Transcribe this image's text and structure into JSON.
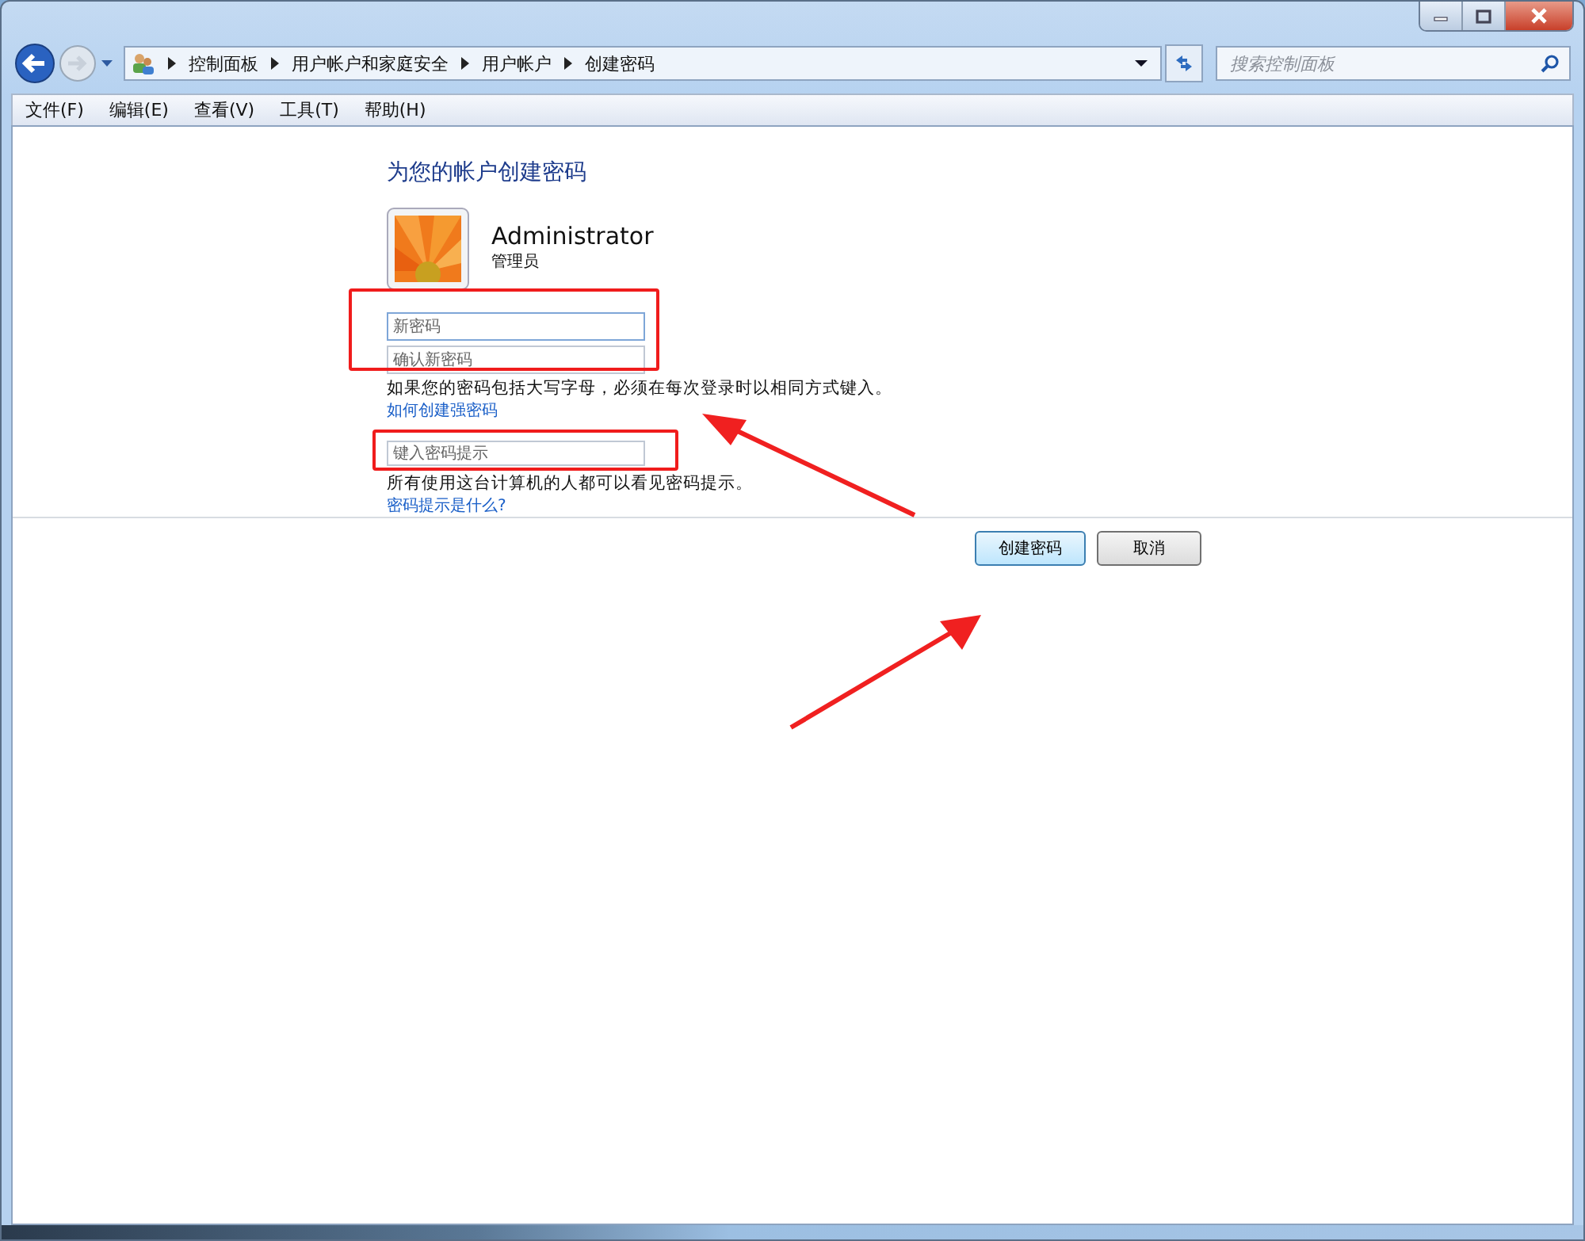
{
  "window": {
    "controls": [
      {
        "kind": "minimize"
      },
      {
        "kind": "maximize"
      },
      {
        "kind": "close"
      }
    ]
  },
  "nav": {
    "breadcrumbs": [
      "控制面板",
      "用户帐户和家庭安全",
      "用户帐户",
      "创建密码"
    ],
    "search": {
      "placeholder": "搜索控制面板"
    }
  },
  "menu": [
    "文件(F)",
    "编辑(E)",
    "查看(V)",
    "工具(T)",
    "帮助(H)"
  ],
  "page": {
    "heading": "为您的帐户创建密码",
    "account": {
      "name": "Administrator",
      "role": "管理员"
    },
    "password_fields": [
      {
        "placeholder": "新密码",
        "focused": true
      },
      {
        "placeholder": "确认新密码",
        "focused": false
      }
    ],
    "case_note": "如果您的密码包括大写字母，必须在每次登录时以相同方式键入。",
    "strong_link": "如何创建强密码",
    "hint_field": {
      "placeholder": "键入密码提示",
      "focused": false
    },
    "hint_note": "所有使用这台计算机的人都可以看见密码提示。",
    "hint_link": "密码提示是什么?",
    "buttons": [
      {
        "label": "创建密码",
        "default": true
      },
      {
        "label": "取消",
        "default": false
      }
    ]
  }
}
